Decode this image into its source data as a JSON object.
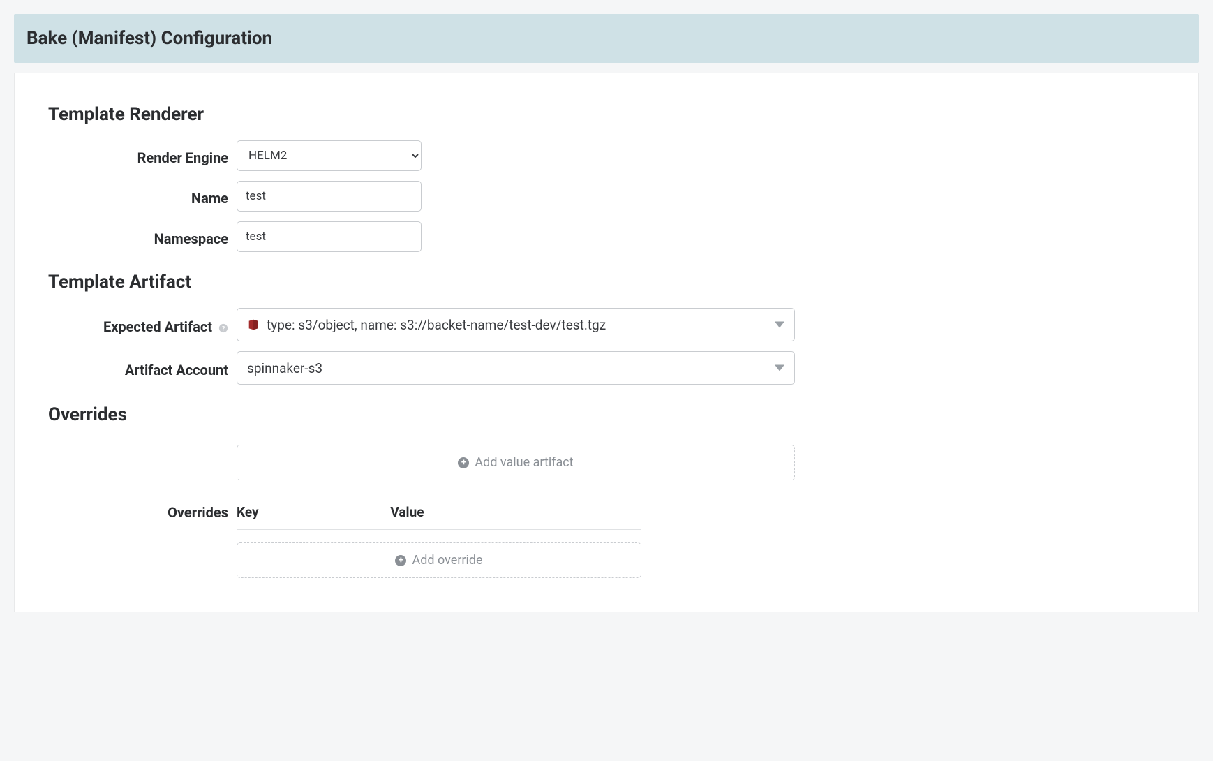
{
  "header": {
    "title": "Bake (Manifest) Configuration"
  },
  "renderer": {
    "section_title": "Template Renderer",
    "render_engine_label": "Render Engine",
    "render_engine_value": "HELM2",
    "name_label": "Name",
    "name_value": "test",
    "namespace_label": "Namespace",
    "namespace_value": "test"
  },
  "artifact": {
    "section_title": "Template Artifact",
    "expected_label": "Expected Artifact",
    "expected_value": "type: s3/object, name: s3://backet-name/test-dev/test.tgz",
    "account_label": "Artifact Account",
    "account_value": "spinnaker-s3"
  },
  "overrides": {
    "section_title": "Overrides",
    "add_value_artifact": "Add value artifact",
    "overrides_label": "Overrides",
    "key_header": "Key",
    "value_header": "Value",
    "add_override": "Add override"
  }
}
